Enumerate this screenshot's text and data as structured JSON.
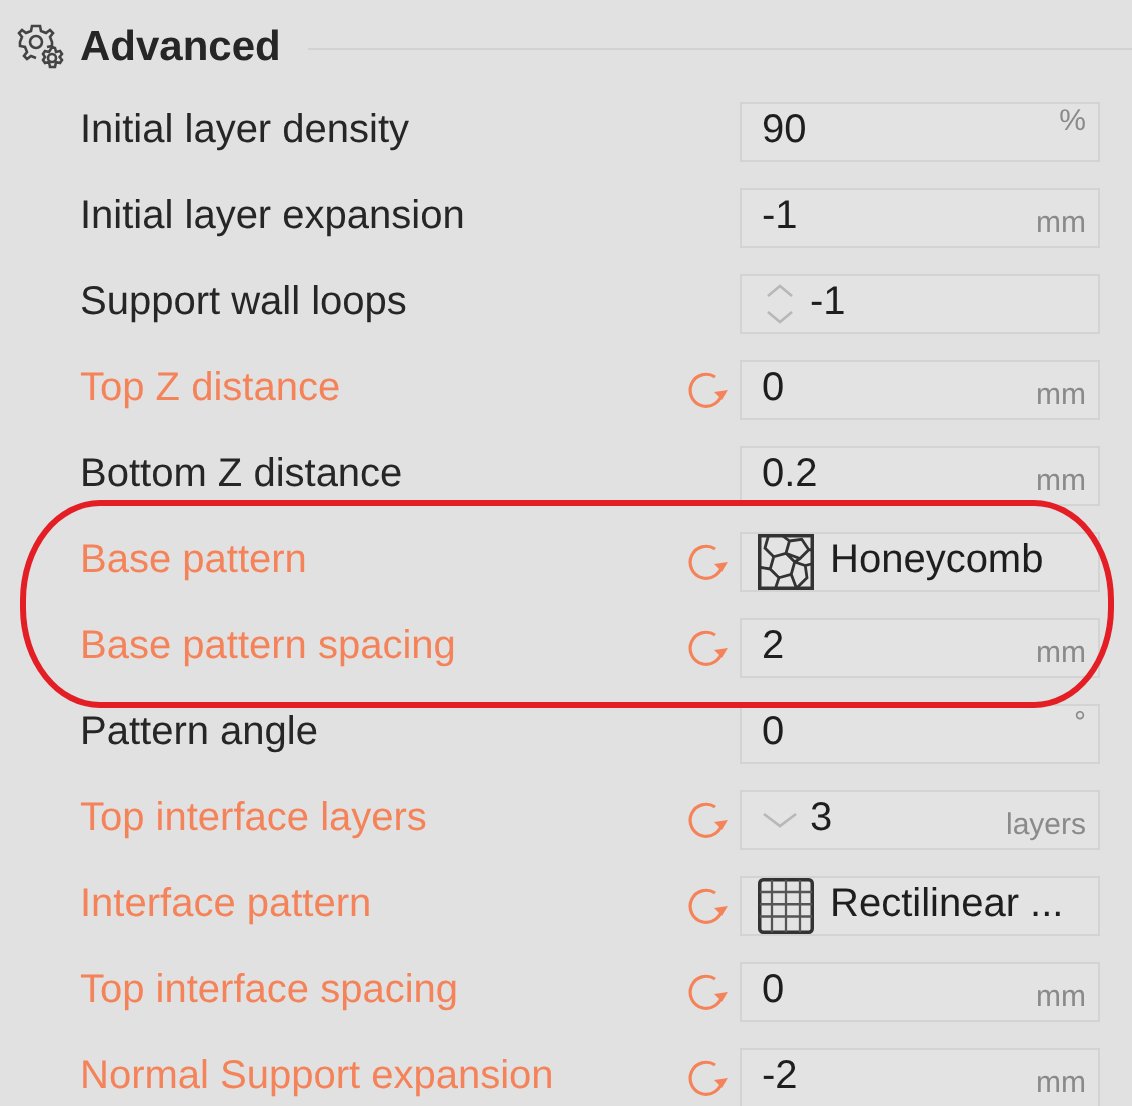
{
  "section": {
    "title": "Advanced"
  },
  "rows": [
    {
      "label": "Initial layer density",
      "kind": "number",
      "value": "90",
      "unit": "%",
      "modified": false,
      "highlighted": false
    },
    {
      "label": "Initial layer expansion",
      "kind": "number",
      "value": "-1",
      "unit": "mm",
      "modified": false,
      "highlighted": false
    },
    {
      "label": "Support wall loops",
      "kind": "spin",
      "value": "-1",
      "modified": false,
      "highlighted": false
    },
    {
      "label": "Top Z distance",
      "kind": "number",
      "value": "0",
      "unit": "mm",
      "modified": true,
      "highlighted": false
    },
    {
      "label": "Bottom Z distance",
      "kind": "number",
      "value": "0.2",
      "unit": "mm",
      "modified": false,
      "highlighted": false
    },
    {
      "label": "Base pattern",
      "kind": "honeycomb",
      "value": "Honeycomb",
      "modified": true,
      "highlighted": true
    },
    {
      "label": "Base pattern spacing",
      "kind": "number",
      "value": "2",
      "unit": "mm",
      "modified": true,
      "highlighted": true
    },
    {
      "label": "Pattern angle",
      "kind": "number",
      "value": "0",
      "unit": "°",
      "modified": false,
      "highlighted": false
    },
    {
      "label": "Top interface layers",
      "kind": "dropdown",
      "value": "3",
      "unit": "layers",
      "modified": true,
      "highlighted": false
    },
    {
      "label": "Interface pattern",
      "kind": "grid",
      "value": "Rectilinear ...",
      "modified": true,
      "highlighted": false
    },
    {
      "label": "Top interface spacing",
      "kind": "number",
      "value": "0",
      "unit": "mm",
      "modified": true,
      "highlighted": false
    },
    {
      "label": "Normal Support expansion",
      "kind": "number",
      "value": "-2",
      "unit": "mm",
      "modified": true,
      "highlighted": false
    }
  ]
}
